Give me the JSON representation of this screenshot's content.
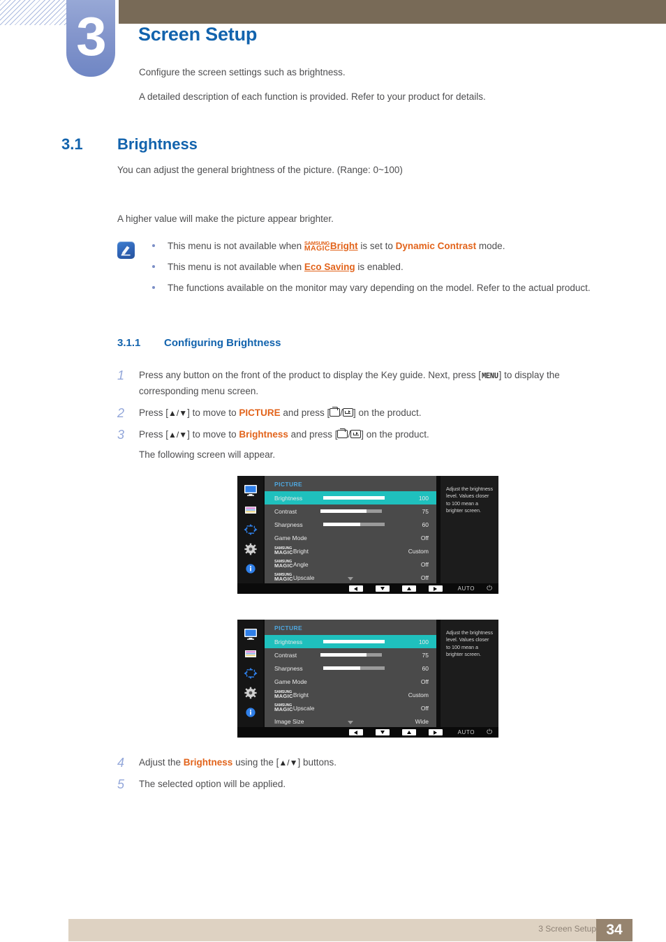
{
  "chapter": {
    "number": "3",
    "title": "Screen Setup",
    "lead1": "Configure the screen settings such as brightness.",
    "lead2": "A detailed description of each function is provided. Refer to your product for details."
  },
  "section": {
    "number": "3.1",
    "title": "Brightness",
    "para1": "You can adjust the general brightness of the picture. (Range: 0~100)",
    "para2": "A higher value will make the picture appear brighter."
  },
  "note": {
    "icon": "note-pencil-icon",
    "items": [
      {
        "pre": "This menu is not available when ",
        "magic_top": "SAMSUNG",
        "magic_bottom": "MAGIC",
        "magic_suffix": "Bright",
        "mid": " is set to ",
        "highlight": "Dynamic Contrast",
        "post": " mode."
      },
      {
        "pre": "This menu is not available when ",
        "link": "Eco Saving",
        "post": " is enabled."
      },
      {
        "text": "The functions available on the monitor may vary depending on the model. Refer to the actual product."
      }
    ]
  },
  "subsection": {
    "number": "3.1.1",
    "title": "Configuring Brightness"
  },
  "steps": {
    "s1": {
      "num": "1",
      "a": "Press any button on the front of the product to display the Key guide. Next, press [",
      "key": "MENU",
      "b": "] to display the corresponding menu screen."
    },
    "s2": {
      "num": "2",
      "a": "Press [",
      "arrows": "▲/▼",
      "b": "] to move to ",
      "target": "PICTURE",
      "c": " and press [",
      "d": "] on the product."
    },
    "s3": {
      "num": "3",
      "a": "Press [",
      "arrows": "▲/▼",
      "b": "] to move to ",
      "target": "Brightness",
      "c": " and press [",
      "d": "] on the product.",
      "follow": "The following screen will appear."
    },
    "s4": {
      "num": "4",
      "a": "Adjust the ",
      "target": "Brightness",
      "b": " using the [",
      "arrows": "▲/▼",
      "c": "] buttons."
    },
    "s5": {
      "num": "5",
      "text": "The selected option will be applied."
    }
  },
  "osd": {
    "accent_selected": "#1fc0bd",
    "header": "PICTURE",
    "tooltip": "Adjust the brightness level. Values closer to 100 mean a brighter screen.",
    "rail_icons": [
      "monitor-icon",
      "color-bars-icon",
      "position-arrows-icon",
      "gear-icon",
      "info-icon"
    ],
    "bottom_bar": {
      "keys": [
        "left-arrow-key",
        "down-arrow-key",
        "up-arrow-key",
        "right-arrow-key"
      ],
      "auto": "AUTO",
      "power": "⏻"
    },
    "menu1": {
      "rows": [
        {
          "label": "Brightness",
          "value": "100",
          "bar": 100,
          "selected": true
        },
        {
          "label": "Contrast",
          "value": "75",
          "bar": 75,
          "selected": false
        },
        {
          "label": "Sharpness",
          "value": "60",
          "bar": 60,
          "selected": false
        },
        {
          "label": "Game Mode",
          "value": "Off",
          "bar": null,
          "selected": false
        },
        {
          "magic": true,
          "magic_top": "SAMSUNG",
          "magic_bottom": "MAGIC",
          "label": "Bright",
          "value": "Custom",
          "bar": null,
          "selected": false
        },
        {
          "magic": true,
          "magic_top": "SAMSUNG",
          "magic_bottom": "MAGIC",
          "label": "Angle",
          "value": "Off",
          "bar": null,
          "selected": false
        },
        {
          "magic": true,
          "magic_top": "SAMSUNG",
          "magic_bottom": "MAGIC",
          "label": "Upscale",
          "value": "Off",
          "bar": null,
          "selected": false
        }
      ]
    },
    "menu2": {
      "rows": [
        {
          "label": "Brightness",
          "value": "100",
          "bar": 100,
          "selected": true
        },
        {
          "label": "Contrast",
          "value": "75",
          "bar": 75,
          "selected": false
        },
        {
          "label": "Sharpness",
          "value": "60",
          "bar": 60,
          "selected": false
        },
        {
          "label": "Game Mode",
          "value": "Off",
          "bar": null,
          "selected": false
        },
        {
          "magic": true,
          "magic_top": "SAMSUNG",
          "magic_bottom": "MAGIC",
          "label": "Bright",
          "value": "Custom",
          "bar": null,
          "selected": false
        },
        {
          "magic": true,
          "magic_top": "SAMSUNG",
          "magic_bottom": "MAGIC",
          "label": "Upscale",
          "value": "Off",
          "bar": null,
          "selected": false
        },
        {
          "label": "Image Size",
          "value": "Wide",
          "bar": null,
          "selected": false
        }
      ]
    }
  },
  "footer": {
    "text": "3 Screen Setup",
    "page": "34"
  }
}
